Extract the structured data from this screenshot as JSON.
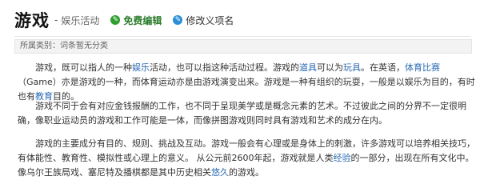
{
  "header": {
    "title": "游戏",
    "dash": "-",
    "category": "娱乐活动",
    "edit_label": "免费编辑",
    "modify_label": "修改义项名"
  },
  "category_bar": {
    "label": "所属类别：",
    "value": "词条暂无分类"
  },
  "paragraphs": [
    {
      "s1": "游戏，既可以指人的一种",
      "l1": "娱乐",
      "s2": "活动，也可以指这种活动过程。游戏的",
      "l2": "道具",
      "s3": "可以为",
      "l3": "玩具",
      "s4": "。在英语，",
      "l4": "体育比赛",
      "s5": "（Game）亦是游戏的一种，而体育运动亦是由游戏演变出来。游戏是一种有组织的玩耍，一般是以娱乐为目的，有时也有",
      "l5": "教育",
      "s6": "目的。"
    },
    {
      "text": "游戏不同于会有对应金钱报酬的工作，也不同于呈现美学或是概念元素的艺术。不过彼此之间的分界不一定很明确，像职业运动员的游戏和工作可能是一体，而像拼图游戏则同时具有游戏和艺术的成分在内。"
    },
    {
      "s1": "游戏的主要成分有目的、规则、挑战及互动。游戏一般会有心理或是身体上的刺激，许多游戏可以培养相关技巧，有体能性、教育性、模拟性或心理上的意义。 从公元前2600年起，游戏就是人类",
      "l1": "经验",
      "s2": "的一部分，出现在所有文化中。像乌尔王族局戏、塞尼特及播棋都是其中历史相关",
      "l2": "悠久",
      "s3": "的游戏。"
    }
  ],
  "colors": {
    "link": "#2a6ab4",
    "edit_green": "#2e9e2e",
    "modify_blue": "#2b8fd6"
  }
}
